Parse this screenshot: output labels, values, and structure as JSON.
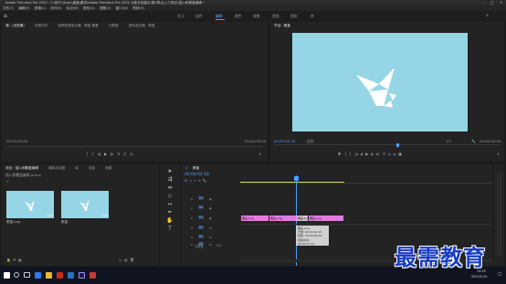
{
  "window": {
    "title": "Adobe Premiere Pro 2020 - C:\\用户\\Ulsoc\\桌面\\素材\\Adobe Premiere Pro 2020 从新手到高手\\第1章\\从入门新手\\插入和覆盖编辑 *"
  },
  "menu": [
    "文件(F)",
    "编辑(E)",
    "剪辑(C)",
    "序列(S)",
    "标记(M)",
    "图形(G)",
    "视图(V)",
    "窗口(W)",
    "帮助(H)"
  ],
  "workspaces": [
    "学习",
    "组件",
    "编辑",
    "颜色",
    "效果",
    "音频",
    "图形",
    "库"
  ],
  "workspace_active": "编辑",
  "source_panel": {
    "tabs": [
      "源：(无剪辑)",
      "效果控件",
      "音频剪辑混合器：覆盖 置置",
      "元数据",
      "音轨混合器：覆盖"
    ],
    "timecode_left": "00;00;00;00",
    "timecode_right": "00;00;00;00"
  },
  "program_panel": {
    "tab": "节目：覆盖",
    "timecode": "00:00:02:18",
    "fit": "适合",
    "fraction": "1/2",
    "duration": "00:00:05:00"
  },
  "project_panel": {
    "tabs": [
      "项目：插入和覆盖编辑",
      "媒体浏览器",
      "库",
      "信息",
      "效果"
    ],
    "path": "插入和覆盖编辑.prproj",
    "items": [
      {
        "name": "覆盖.png",
        "duration": "4:29"
      },
      {
        "name": "覆盖",
        "duration": "4:29"
      }
    ]
  },
  "timeline": {
    "tab": "覆盖",
    "timecode": "00:00:02:18",
    "tracks": [
      "V3",
      "V2",
      "V1",
      "A1",
      "A2",
      "A3"
    ],
    "master": "主声道",
    "master_value": "0.0",
    "clips": [
      {
        "label": "覆盖.png"
      },
      {
        "label": "覆盖.png"
      },
      {
        "label": "覆盖.png"
      },
      {
        "label": "覆盖.png"
      }
    ]
  },
  "tooltip": {
    "lines": [
      "覆盖.png",
      "开始: 00:00:02:18",
      "结束: 00:00:04:29",
      "持续时间: 00:00:02:12"
    ]
  },
  "status": "单击以选择,或单击空白处并拖动以进行框选。使用 Alt、Shift 和 Ctrl 可获得其他选项。",
  "taskbar": {
    "time": "14:25",
    "date": "2022/1/10"
  },
  "watermark": "最需教育",
  "colors": {
    "accent": "#4ba0ff",
    "preview_bg": "#96d5e5",
    "clip": "#e07be0",
    "playhead": "#4ba0ff"
  }
}
